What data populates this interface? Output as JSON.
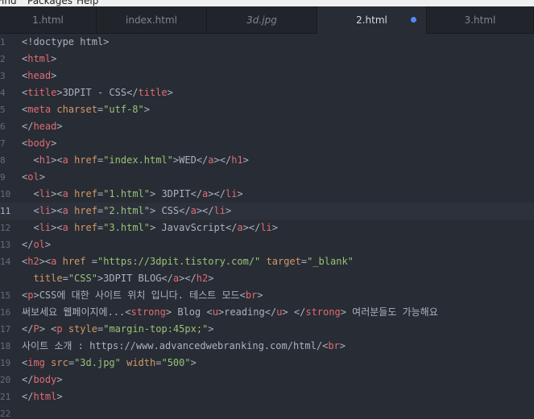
{
  "menubar": {
    "items": [
      "Find",
      "Packages",
      "Help"
    ]
  },
  "tabs": [
    {
      "label": "1.html",
      "italic": false,
      "active": false,
      "modified": false
    },
    {
      "label": "index.html",
      "italic": false,
      "active": false,
      "modified": false
    },
    {
      "label": "3d.jpg",
      "italic": true,
      "active": false,
      "modified": false
    },
    {
      "label": "2.html",
      "italic": false,
      "active": true,
      "modified": true
    },
    {
      "label": "3.html",
      "italic": false,
      "active": false,
      "modified": false
    }
  ],
  "editor": {
    "cursor_line": 11,
    "lines": [
      {
        "n": "1",
        "tokens": [
          [
            "pn",
            "<!doctype html>"
          ]
        ]
      },
      {
        "n": "2",
        "tokens": [
          [
            "pn",
            "<"
          ],
          [
            "tg",
            "html"
          ],
          [
            "pn",
            ">"
          ]
        ]
      },
      {
        "n": "3",
        "tokens": [
          [
            "pn",
            "<"
          ],
          [
            "tg",
            "head"
          ],
          [
            "pn",
            ">"
          ]
        ]
      },
      {
        "n": "4",
        "tokens": [
          [
            "pn",
            "<"
          ],
          [
            "tg",
            "title"
          ],
          [
            "pn",
            ">"
          ],
          [
            "tx",
            "3DPIT - CSS"
          ],
          [
            "pn",
            "</"
          ],
          [
            "tg",
            "title"
          ],
          [
            "pn",
            ">"
          ]
        ]
      },
      {
        "n": "5",
        "tokens": [
          [
            "pn",
            "<"
          ],
          [
            "tg",
            "meta"
          ],
          [
            "tx",
            " "
          ],
          [
            "at",
            "charset"
          ],
          [
            "pn",
            "="
          ],
          [
            "st",
            "\"utf-8\""
          ],
          [
            "pn",
            ">"
          ]
        ]
      },
      {
        "n": "6",
        "tokens": [
          [
            "pn",
            "</"
          ],
          [
            "tg",
            "head"
          ],
          [
            "pn",
            ">"
          ]
        ]
      },
      {
        "n": "7",
        "tokens": [
          [
            "pn",
            "<"
          ],
          [
            "tg",
            "body"
          ],
          [
            "pn",
            ">"
          ]
        ]
      },
      {
        "n": "8",
        "tokens": [
          [
            "tx",
            "  "
          ],
          [
            "pn",
            "<"
          ],
          [
            "tg",
            "h1"
          ],
          [
            "pn",
            "><"
          ],
          [
            "tg",
            "a"
          ],
          [
            "tx",
            " "
          ],
          [
            "at",
            "href"
          ],
          [
            "pn",
            "="
          ],
          [
            "st",
            "\"index.html\""
          ],
          [
            "pn",
            ">"
          ],
          [
            "tx",
            "WED"
          ],
          [
            "pn",
            "</"
          ],
          [
            "tg",
            "a"
          ],
          [
            "pn",
            "></"
          ],
          [
            "tg",
            "h1"
          ],
          [
            "pn",
            ">"
          ]
        ]
      },
      {
        "n": "9",
        "tokens": [
          [
            "pn",
            "<"
          ],
          [
            "tg",
            "ol"
          ],
          [
            "pn",
            ">"
          ]
        ]
      },
      {
        "n": "10",
        "tokens": [
          [
            "tx",
            "  "
          ],
          [
            "pn",
            "<"
          ],
          [
            "tg",
            "li"
          ],
          [
            "pn",
            "><"
          ],
          [
            "tg",
            "a"
          ],
          [
            "tx",
            " "
          ],
          [
            "at",
            "href"
          ],
          [
            "pn",
            "="
          ],
          [
            "st",
            "\"1.html\""
          ],
          [
            "pn",
            ">"
          ],
          [
            "tx",
            " 3DPIT"
          ],
          [
            "pn",
            "</"
          ],
          [
            "tg",
            "a"
          ],
          [
            "pn",
            "></"
          ],
          [
            "tg",
            "li"
          ],
          [
            "pn",
            ">"
          ]
        ]
      },
      {
        "n": "11",
        "tokens": [
          [
            "tx",
            "  "
          ],
          [
            "pn",
            "<"
          ],
          [
            "tg",
            "li"
          ],
          [
            "pn",
            "><"
          ],
          [
            "tg",
            "a"
          ],
          [
            "tx",
            " "
          ],
          [
            "at",
            "href"
          ],
          [
            "pn",
            "="
          ],
          [
            "st",
            "\"2.html\""
          ],
          [
            "pn",
            ">"
          ],
          [
            "tx",
            " CSS"
          ],
          [
            "pn",
            "</"
          ],
          [
            "tg",
            "a"
          ],
          [
            "pn",
            "></"
          ],
          [
            "tg",
            "li"
          ],
          [
            "pn",
            ">"
          ]
        ]
      },
      {
        "n": "12",
        "tokens": [
          [
            "tx",
            "  "
          ],
          [
            "pn",
            "<"
          ],
          [
            "tg",
            "li"
          ],
          [
            "pn",
            "><"
          ],
          [
            "tg",
            "a"
          ],
          [
            "tx",
            " "
          ],
          [
            "at",
            "href"
          ],
          [
            "pn",
            "="
          ],
          [
            "st",
            "\"3.html\""
          ],
          [
            "pn",
            ">"
          ],
          [
            "tx",
            " JavavScript"
          ],
          [
            "pn",
            "</"
          ],
          [
            "tg",
            "a"
          ],
          [
            "pn",
            "></"
          ],
          [
            "tg",
            "li"
          ],
          [
            "pn",
            ">"
          ]
        ]
      },
      {
        "n": "13",
        "tokens": [
          [
            "pn",
            "</"
          ],
          [
            "tg",
            "ol"
          ],
          [
            "pn",
            ">"
          ]
        ]
      },
      {
        "n": "14",
        "tokens": [
          [
            "pn",
            "<"
          ],
          [
            "tg",
            "h2"
          ],
          [
            "pn",
            "><"
          ],
          [
            "tg",
            "a"
          ],
          [
            "tx",
            " "
          ],
          [
            "at",
            "href"
          ],
          [
            "tx",
            " "
          ],
          [
            "pn",
            "="
          ],
          [
            "st",
            "\"https://3dpit.tistory.com/\""
          ],
          [
            "tx",
            " "
          ],
          [
            "at",
            "target"
          ],
          [
            "pn",
            "="
          ],
          [
            "st",
            "\"_blank\""
          ]
        ]
      },
      {
        "n": "",
        "tokens": [
          [
            "tx",
            "  "
          ],
          [
            "at",
            "title"
          ],
          [
            "pn",
            "="
          ],
          [
            "st",
            "\"CSS\""
          ],
          [
            "pn",
            ">"
          ],
          [
            "tx",
            "3DPIT BLOG"
          ],
          [
            "pn",
            "</"
          ],
          [
            "tg",
            "a"
          ],
          [
            "pn",
            "></"
          ],
          [
            "tg",
            "h2"
          ],
          [
            "pn",
            ">"
          ]
        ]
      },
      {
        "n": "15",
        "tokens": [
          [
            "pn",
            "<"
          ],
          [
            "tg",
            "p"
          ],
          [
            "pn",
            ">"
          ],
          [
            "tx",
            "CSS에 대한 사이트 위치 입니다. 테스트 모드"
          ],
          [
            "pn",
            "<"
          ],
          [
            "tg",
            "br"
          ],
          [
            "pn",
            ">"
          ]
        ]
      },
      {
        "n": "16",
        "tokens": [
          [
            "tx",
            "써보세요 웹페이지에..."
          ],
          [
            "pn",
            "<"
          ],
          [
            "tg",
            "strong"
          ],
          [
            "pn",
            ">"
          ],
          [
            "tx",
            " Blog "
          ],
          [
            "pn",
            "<"
          ],
          [
            "tg",
            "u"
          ],
          [
            "pn",
            ">"
          ],
          [
            "tx",
            "reading"
          ],
          [
            "pn",
            "</"
          ],
          [
            "tg",
            "u"
          ],
          [
            "pn",
            ">"
          ],
          [
            "tx",
            " "
          ],
          [
            "pn",
            "</"
          ],
          [
            "tg",
            "strong"
          ],
          [
            "pn",
            ">"
          ],
          [
            "tx",
            " 여러분들도 가능해요"
          ]
        ]
      },
      {
        "n": "17",
        "tokens": [
          [
            "pn",
            "</"
          ],
          [
            "tg",
            "P"
          ],
          [
            "pn",
            ">"
          ],
          [
            "tx",
            " "
          ],
          [
            "pn",
            "<"
          ],
          [
            "tg",
            "p"
          ],
          [
            "tx",
            " "
          ],
          [
            "at",
            "style"
          ],
          [
            "pn",
            "="
          ],
          [
            "st",
            "\"margin-top:45px;\""
          ],
          [
            "pn",
            ">"
          ]
        ]
      },
      {
        "n": "18",
        "tokens": [
          [
            "tx",
            "사이트 소개 : https://www.advancedwebranking.com/html/"
          ],
          [
            "pn",
            "<"
          ],
          [
            "tg",
            "br"
          ],
          [
            "pn",
            ">"
          ]
        ]
      },
      {
        "n": "19",
        "tokens": [
          [
            "pn",
            "<"
          ],
          [
            "tg",
            "img"
          ],
          [
            "tx",
            " "
          ],
          [
            "at",
            "src"
          ],
          [
            "pn",
            "="
          ],
          [
            "st",
            "\"3d.jpg\""
          ],
          [
            "tx",
            " "
          ],
          [
            "at",
            "width"
          ],
          [
            "pn",
            "="
          ],
          [
            "st",
            "\"500\""
          ],
          [
            "pn",
            ">"
          ]
        ]
      },
      {
        "n": "20",
        "tokens": [
          [
            "pn",
            "</"
          ],
          [
            "tg",
            "body"
          ],
          [
            "pn",
            ">"
          ]
        ]
      },
      {
        "n": "21",
        "tokens": [
          [
            "pn",
            "</"
          ],
          [
            "tg",
            "html"
          ],
          [
            "pn",
            ">"
          ]
        ]
      },
      {
        "n": "22",
        "tokens": []
      }
    ]
  },
  "colors": {
    "editor_bg": "#282c34",
    "tag": "#e06c75",
    "attribute": "#d19a66",
    "string": "#98c379",
    "text": "#abb2bf",
    "modified_dot": "#568af2"
  }
}
